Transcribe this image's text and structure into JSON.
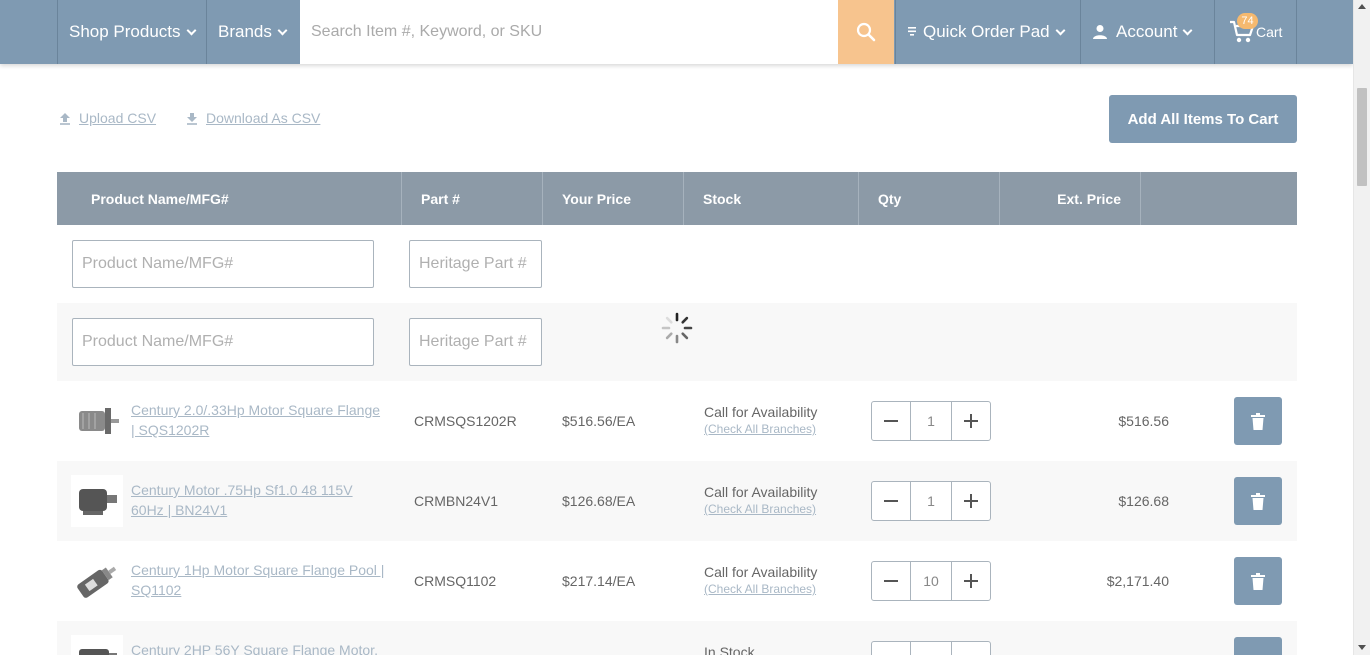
{
  "header": {
    "shop_products": "Shop Products",
    "brands": "Brands",
    "search_placeholder": "Search Item #, Keyword, or SKU",
    "quick_order_pad": "Quick Order Pad",
    "account": "Account",
    "cart": "Cart",
    "cart_count": "74"
  },
  "actions": {
    "upload_csv": "Upload CSV",
    "download_csv": "Download As CSV",
    "add_all": "Add All Items To Cart"
  },
  "table": {
    "headers": {
      "product": "Product Name/MFG#",
      "part": "Part #",
      "price": "Your Price",
      "stock": "Stock",
      "qty": "Qty",
      "ext": "Ext. Price"
    },
    "input_rows": [
      {
        "product_placeholder": "Product Name/MFG#",
        "part_placeholder": "Heritage Part #"
      },
      {
        "product_placeholder": "Product Name/MFG#",
        "part_placeholder": "Heritage Part #"
      }
    ],
    "items": [
      {
        "name": "Century 2.0/.33Hp Motor Square Flange | SQS1202R",
        "part": "CRMSQS1202R",
        "price": "$516.56/EA",
        "stock": "Call for Availability",
        "branches": "(Check All Branches)",
        "qty": "1",
        "ext": "$516.56"
      },
      {
        "name": "Century Motor .75Hp Sf1.0 48 115V 60Hz | BN24V1",
        "part": "CRMBN24V1",
        "price": "$126.68/EA",
        "stock": "Call for Availability",
        "branches": "(Check All Branches)",
        "qty": "1",
        "ext": "$126.68"
      },
      {
        "name": "Century 1Hp Motor Square Flange Pool | SQ1102",
        "part": "CRMSQ1102",
        "price": "$217.14/EA",
        "stock": "Call for Availability",
        "branches": "(Check All Branches)",
        "qty": "10",
        "ext": "$2,171.40"
      },
      {
        "name": "Century 2HP 56Y Square Flange Motor,",
        "part": "",
        "price": "",
        "stock": "In Stock",
        "branches": "",
        "qty": "",
        "ext": ""
      }
    ]
  },
  "colors": {
    "header_bg": "#7f9ab2",
    "search_button": "#f7c48e",
    "table_header": "#8c9aa7",
    "link": "#a9b8c6"
  }
}
